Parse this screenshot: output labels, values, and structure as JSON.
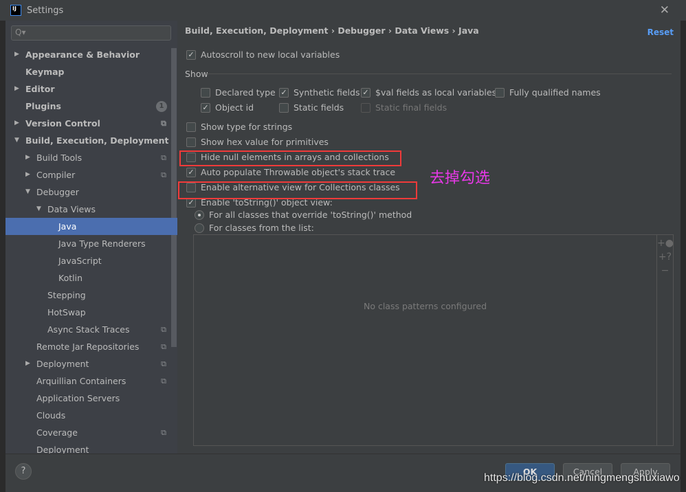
{
  "window": {
    "title": "Settings",
    "logo": "IJ"
  },
  "search": {
    "placeholder": "Q▾"
  },
  "sidebar": {
    "items": [
      {
        "label": "Appearance & Behavior",
        "arrow": "▶"
      },
      {
        "label": "Keymap"
      },
      {
        "label": "Editor",
        "arrow": "▶"
      },
      {
        "label": "Plugins",
        "badge": "1"
      },
      {
        "label": "Version Control",
        "arrow": "▶"
      },
      {
        "label": "Build, Execution, Deployment",
        "arrow": "▼"
      },
      {
        "label": "Build Tools",
        "arrow": "▶"
      },
      {
        "label": "Compiler",
        "arrow": "▶"
      },
      {
        "label": "Debugger",
        "arrow": "▼"
      },
      {
        "label": "Data Views",
        "arrow": "▼"
      },
      {
        "label": "Java"
      },
      {
        "label": "Java Type Renderers"
      },
      {
        "label": "JavaScript"
      },
      {
        "label": "Kotlin"
      },
      {
        "label": "Stepping"
      },
      {
        "label": "HotSwap"
      },
      {
        "label": "Async Stack Traces"
      },
      {
        "label": "Remote Jar Repositories"
      },
      {
        "label": "Deployment",
        "arrow": "▶"
      },
      {
        "label": "Arquillian Containers"
      },
      {
        "label": "Application Servers"
      },
      {
        "label": "Clouds"
      },
      {
        "label": "Coverage"
      },
      {
        "label": "Deployment"
      }
    ]
  },
  "breadcrumb": "Build, Execution, Deployment  ›  Debugger  ›  Data Views  ›  Java",
  "reset": "Reset",
  "options": {
    "autoscroll": {
      "label": "Autoscroll to new local variables",
      "checked": true
    },
    "show_label": "Show",
    "declared_type": {
      "label": "Declared type",
      "checked": false
    },
    "synthetic": {
      "label": "Synthetic fields",
      "checked": true
    },
    "val_fields": {
      "label": "$val fields as local variables",
      "checked": true
    },
    "fq_names": {
      "label": "Fully qualified names",
      "checked": false
    },
    "object_id": {
      "label": "Object id",
      "checked": true
    },
    "static_fields": {
      "label": "Static fields",
      "checked": false
    },
    "static_final": {
      "label": "Static final fields",
      "checked": false
    },
    "type_strings": {
      "label": "Show type for strings",
      "checked": false
    },
    "hex": {
      "label": "Show hex value for primitives",
      "checked": false
    },
    "hide_null": {
      "label": "Hide null elements in arrays and collections",
      "checked": false
    },
    "throwable": {
      "label": "Auto populate Throwable object's stack trace",
      "checked": true
    },
    "alt_view": {
      "label": "Enable alternative view for Collections classes",
      "checked": false
    },
    "tostring": {
      "label": "Enable 'toString()' object view:",
      "checked": true
    },
    "radio_all": {
      "label": "For all classes that override 'toString()' method",
      "selected": true
    },
    "radio_list": {
      "label": "For classes from the list:",
      "selected": false
    }
  },
  "list": {
    "empty": "No class patterns configured",
    "tools": [
      "+●",
      "+?",
      "−"
    ]
  },
  "annotation": "去掉勾选",
  "footer": {
    "help": "?",
    "ok": "OK",
    "cancel": "Cancel",
    "apply": "Apply"
  },
  "watermark": "https://blog.csdn.net/ningmengshuxiawo",
  "colors": {
    "selection": "#4b6eaf",
    "annotation": "#e838e8",
    "highlight": "#f03a3a",
    "link": "#589df6"
  }
}
